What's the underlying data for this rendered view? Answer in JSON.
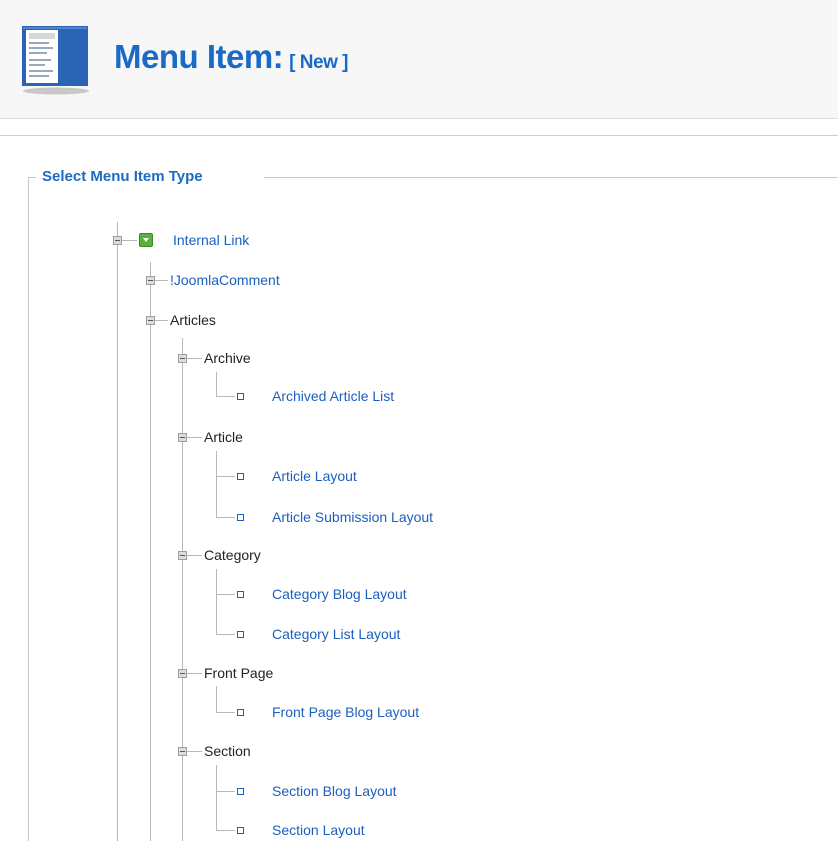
{
  "header": {
    "title": "Menu Item:",
    "subtitle": "[ New ]"
  },
  "fieldset": {
    "legend": "Select Menu Item Type"
  },
  "tree": {
    "root": "Internal Link",
    "joomla_comment": "!JoomlaComment",
    "articles": "Articles",
    "archive": {
      "label": "Archive",
      "items": [
        "Archived Article List"
      ]
    },
    "article": {
      "label": "Article",
      "items": [
        "Article Layout",
        "Article Submission Layout"
      ]
    },
    "category": {
      "label": "Category",
      "items": [
        "Category Blog Layout",
        "Category List Layout"
      ]
    },
    "frontpage": {
      "label": "Front Page",
      "items": [
        "Front Page Blog Layout"
      ]
    },
    "section": {
      "label": "Section",
      "items": [
        "Section Blog Layout",
        "Section Layout"
      ]
    }
  },
  "colors": {
    "link": "#1b5fbf",
    "title": "#1b6bc6",
    "header_bg": "#f7f7f7",
    "green": "#59b13b"
  }
}
